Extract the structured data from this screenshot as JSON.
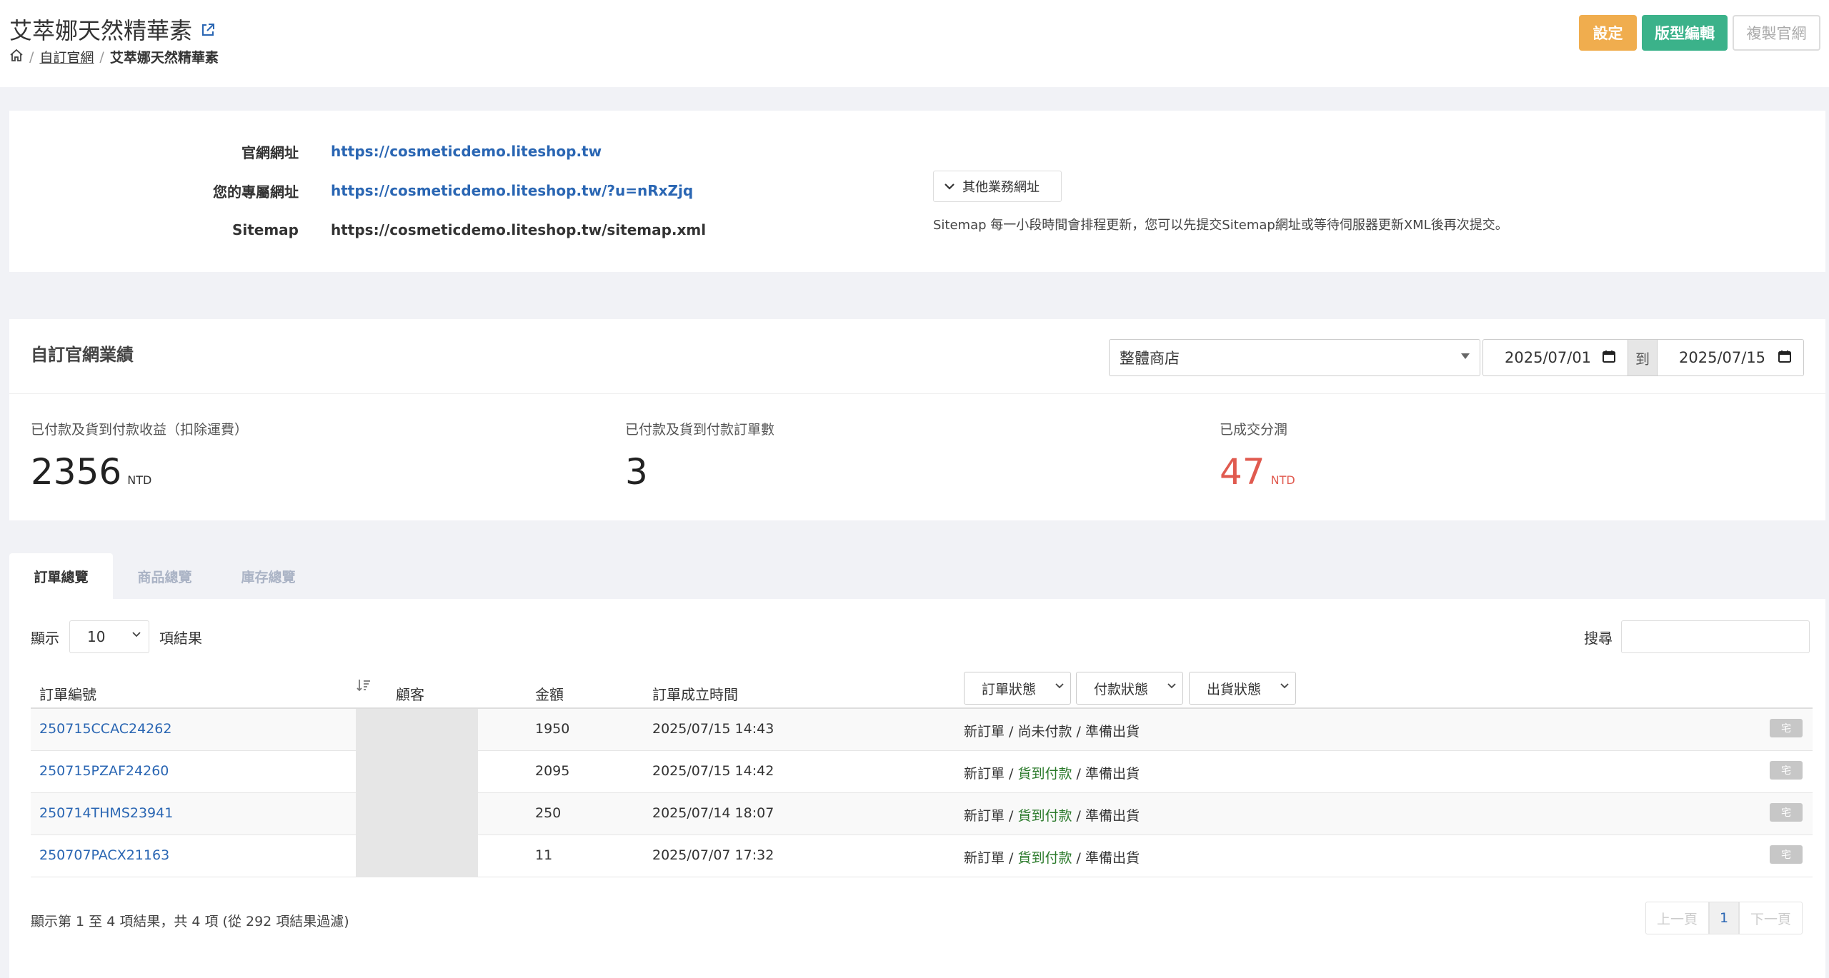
{
  "header": {
    "title": "艾萃娜天然精華素",
    "breadcrumb": {
      "parent": "自訂官網",
      "current": "艾萃娜天然精華素"
    },
    "buttons": {
      "settings": "設定",
      "template_edit": "版型編輯",
      "copy_site": "複製官網"
    }
  },
  "urls": {
    "site_label": "官網網址",
    "site_value": "https://cosmeticdemo.liteshop.tw",
    "personal_label": "您的專屬網址",
    "personal_value": "https://cosmeticdemo.liteshop.tw/?u=nRxZjq",
    "sitemap_label": "Sitemap",
    "sitemap_value": "https://cosmeticdemo.liteshop.tw/sitemap.xml",
    "other_addresses_label": "其他業務網址",
    "sitemap_note": "Sitemap 每一小段時間會排程更新，您可以先提交Sitemap網址或等待伺服器更新XML後再次提交。"
  },
  "performance": {
    "title": "自訂官網業績",
    "store_select": "整體商店",
    "date_from": "2025/07/01",
    "date_to_label": "到",
    "date_to": "2025/07/15",
    "stats": [
      {
        "label": "已付款及貨到付款收益（扣除運費）",
        "value": "2356",
        "unit": "NTD"
      },
      {
        "label": "已付款及貨到付款訂單數",
        "value": "3",
        "unit": ""
      },
      {
        "label": "已成交分潤",
        "value": "47",
        "unit": "NTD"
      }
    ],
    "accent_red": "#e05a4f"
  },
  "tabs": [
    "訂單總覽",
    "商品總覽",
    "庫存總覽"
  ],
  "orders": {
    "show_label": "顯示",
    "page_length": "10",
    "results_label": "項結果",
    "search_label": "搜尋",
    "columns": {
      "order_no": "訂單編號",
      "customer": "顧客",
      "amount": "金額",
      "created": "訂單成立時間"
    },
    "filters": {
      "order_status": "訂單狀態",
      "payment_status": "付款狀態",
      "shipping_status": "出貨狀態"
    },
    "rows": [
      {
        "order_no": "250715CCAC24262",
        "amount": "1950",
        "created": "2025/07/15 14:43",
        "status_order": "新訂單",
        "status_pay": "尚未付款",
        "status_ship": "準備出貨",
        "badge": "宅"
      },
      {
        "order_no": "250715PZAF24260",
        "amount": "2095",
        "created": "2025/07/15 14:42",
        "status_order": "新訂單",
        "status_pay": "貨到付款",
        "status_ship": "準備出貨",
        "badge": "宅"
      },
      {
        "order_no": "250714THMS23941",
        "amount": "250",
        "created": "2025/07/14 18:07",
        "status_order": "新訂單",
        "status_pay": "貨到付款",
        "status_ship": "準備出貨",
        "badge": "宅"
      },
      {
        "order_no": "250707PACX21163",
        "amount": "11",
        "created": "2025/07/07 17:32",
        "status_order": "新訂單",
        "status_pay": "貨到付款",
        "status_ship": "準備出貨",
        "badge": "宅"
      }
    ],
    "info": "顯示第 1 至 4 項結果，共 4 項 (從 292 項結果過濾)",
    "pager": {
      "prev": "上一頁",
      "current": "1",
      "next": "下一頁"
    }
  },
  "colors": {
    "link": "#2a66b3",
    "green_status": "#2b7a2b",
    "btn_orange": "#f0ad4e",
    "btn_green": "#3bb28a"
  }
}
